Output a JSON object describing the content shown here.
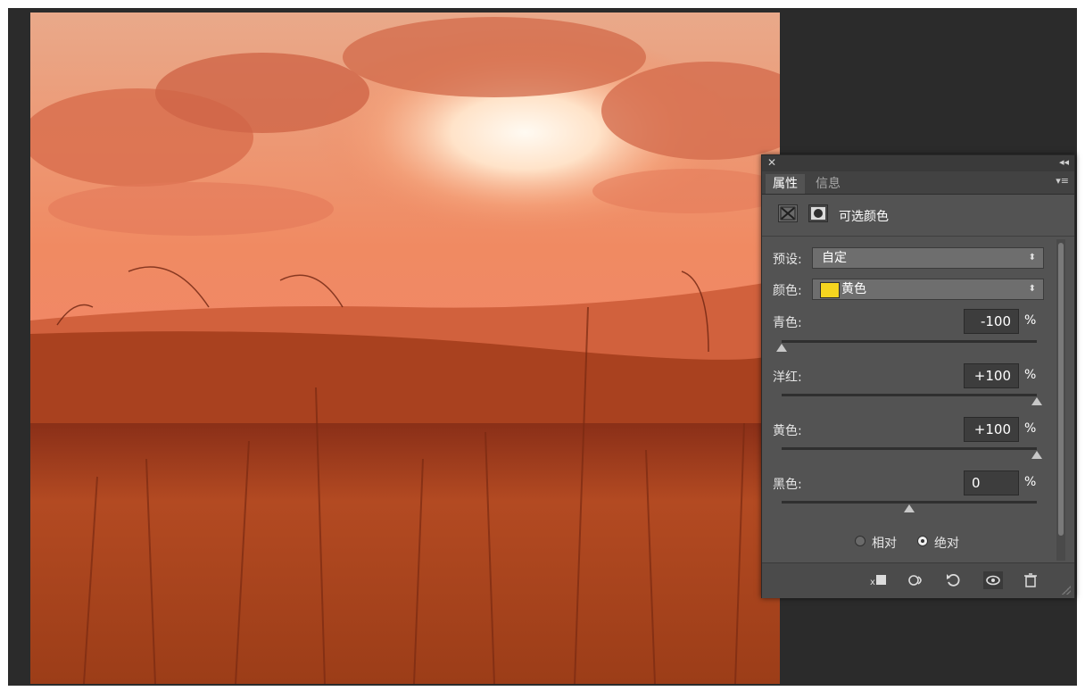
{
  "panel": {
    "tabs": [
      {
        "label": "属性"
      },
      {
        "label": "信息"
      }
    ],
    "adjustment_title": "可选颜色",
    "preset_label": "预设:",
    "preset_value": "自定",
    "color_label": "颜色:",
    "color_value": "黄色",
    "swatch_color": "#f5d51f",
    "sliders": [
      {
        "label": "青色:",
        "value": "-100",
        "unit": "%",
        "level": -100
      },
      {
        "label": "洋红:",
        "value": "+100",
        "unit": "%",
        "level": 100
      },
      {
        "label": "黄色:",
        "value": "+100",
        "unit": "%",
        "level": 100
      },
      {
        "label": "黑色:",
        "value": "0",
        "unit": "%",
        "level": 0
      }
    ],
    "method_options": [
      {
        "label": "相对",
        "selected": false
      },
      {
        "label": "绝对",
        "selected": true
      }
    ],
    "footer_icons": [
      "clip-to-layer-icon",
      "view-previous-icon",
      "reset-icon",
      "visibility-eye-icon",
      "trash-icon"
    ]
  }
}
